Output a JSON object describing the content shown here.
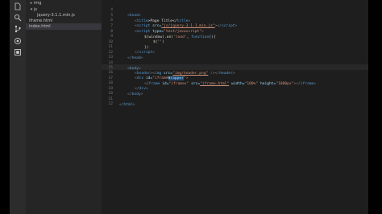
{
  "sidebar": {
    "items": [
      {
        "label": "img",
        "kind": "folder"
      },
      {
        "label": "js",
        "kind": "folder"
      },
      {
        "label": "jquery-3.1.1.min.js",
        "kind": "file"
      },
      {
        "label": "iframe.html",
        "kind": "file"
      },
      {
        "label": "index.html",
        "kind": "file"
      }
    ]
  },
  "activity_icons": [
    "files-icon",
    "search-icon",
    "git-icon",
    "debug-icon",
    "extensions-icon"
  ],
  "editor": {
    "line_numbers": [
      "4",
      "5",
      "6",
      "7",
      "8",
      "9",
      "10",
      "11",
      "12",
      "13",
      "14",
      "15",
      "16",
      "17",
      "18",
      "19",
      "20",
      "21",
      "22"
    ],
    "tokens": {
      "head_open_a": "<",
      "head_open_b": "head",
      "head_open_c": ">",
      "title_line_a": "<",
      "title_line_b": "title",
      "title_line_c": ">Page Title</",
      "title_line_d": "title",
      "title_line_e": ">",
      "script1_a": "<",
      "script1_b": "script",
      "script1_c": " src=",
      "script1_d": "\"js/jquery-3.1.1.min.js\"",
      "script1_e": "></",
      "script1_f": "script",
      "script1_g": ">",
      "script2_a": "<",
      "script2_b": "script",
      "script2_c": " type=",
      "script2_d": "\"text/javascript\"",
      "script2_e": ">",
      "js1_a": "$",
      "js1_b": "(window).",
      "js1_c": "on",
      "js1_d": "(",
      "js1_e": "'load'",
      "js1_f": ", ",
      "js1_g": "function",
      "js1_h": "(){",
      "js2_a": "$",
      "js2_b": "('')",
      "js3": "})",
      "script_close_a": "</",
      "script_close_b": "script",
      "script_close_c": ">",
      "head_close_a": "</",
      "head_close_b": "head",
      "head_close_c": ">",
      "body_open_a": "<",
      "body_open_b": "body",
      "body_open_c": ">",
      "header_a": "<",
      "header_b": "header",
      "header_c": "><",
      "header_d": "img",
      "header_e": " src=",
      "header_f": "\"img/header.png\"",
      "header_g": " /></",
      "header_h": "header",
      "header_i": ">",
      "div_a": "<",
      "div_b": "div",
      "div_c": " id=",
      "div_d": "\"iframe",
      "div_e": "Wrapper",
      "div_f": "\"",
      "div_g": ">",
      "iframe_a": "<",
      "iframe_b": "iframe",
      "iframe_c": " id=",
      "iframe_d": "\"iframes\"",
      "iframe_e": " src=",
      "iframe_f": "\"iframe.html\"",
      "iframe_g": " width=",
      "iframe_h": "\"100%\"",
      "iframe_i": " height=",
      "iframe_j": "\"1000px\"",
      "iframe_k": "></",
      "iframe_l": "iframe",
      "iframe_m": ">",
      "divclose_a": "</",
      "divclose_b": "div",
      "divclose_c": ">",
      "bodyclose_a": "</",
      "bodyclose_b": "body",
      "bodyclose_c": ">",
      "htmlclose_a": "</",
      "htmlclose_b": "html",
      "htmlclose_c": ">"
    }
  }
}
